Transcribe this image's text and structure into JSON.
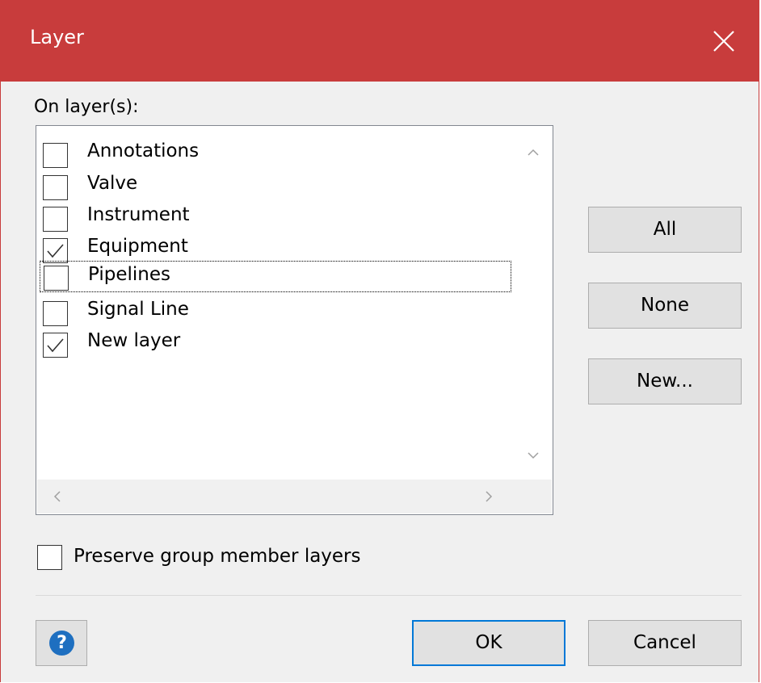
{
  "window": {
    "title": "Layer",
    "accent": "#c83c3c"
  },
  "layers": {
    "label": "On layer(s):",
    "items": [
      {
        "label": "Annotations",
        "checked": false
      },
      {
        "label": "Valve",
        "checked": false
      },
      {
        "label": "Instrument",
        "checked": false
      },
      {
        "label": "Equipment",
        "checked": true
      },
      {
        "label": "Pipelines",
        "checked": false,
        "focused": true
      },
      {
        "label": "Signal Line",
        "checked": false
      },
      {
        "label": "New layer",
        "checked": true
      }
    ]
  },
  "buttons": {
    "all": "All",
    "none": "None",
    "new": "New...",
    "ok": "OK",
    "cancel": "Cancel"
  },
  "options": {
    "preserve_label": "Preserve group member layers",
    "preserve_checked": false
  },
  "icons": {
    "close": "close-icon",
    "help": "help-icon",
    "help_glyph": "?"
  }
}
